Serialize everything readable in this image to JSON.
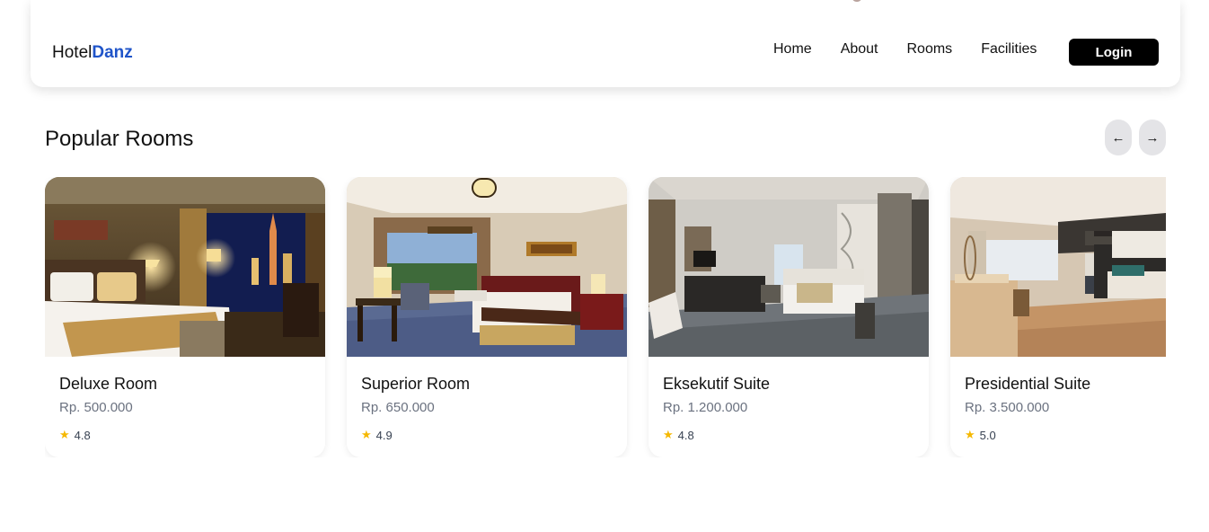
{
  "brand": {
    "name_part1": "Hotel",
    "name_part2": "Danz",
    "accent_color": "#1f54c9"
  },
  "nav": {
    "links": [
      "Home",
      "About",
      "Rooms",
      "Facilities"
    ],
    "login_label": "Login"
  },
  "section": {
    "title": "Popular Rooms",
    "prev_icon": "←",
    "next_icon": "→"
  },
  "rooms": [
    {
      "name": "Deluxe Room",
      "price": "Rp. 500.000",
      "rating": "4.8"
    },
    {
      "name": "Superior Room",
      "price": "Rp. 650.000",
      "rating": "4.9"
    },
    {
      "name": "Eksekutif Suite",
      "price": "Rp. 1.200.000",
      "rating": "4.8"
    },
    {
      "name": "Presidential Suite",
      "price": "Rp. 3.500.000",
      "rating": "5.0"
    }
  ],
  "icons": {
    "star": "star-icon",
    "prev": "arrow-left-icon",
    "next": "arrow-right-icon"
  },
  "colors": {
    "star": "#f5b800",
    "login_bg": "#000000",
    "price_text": "#6b7280"
  }
}
